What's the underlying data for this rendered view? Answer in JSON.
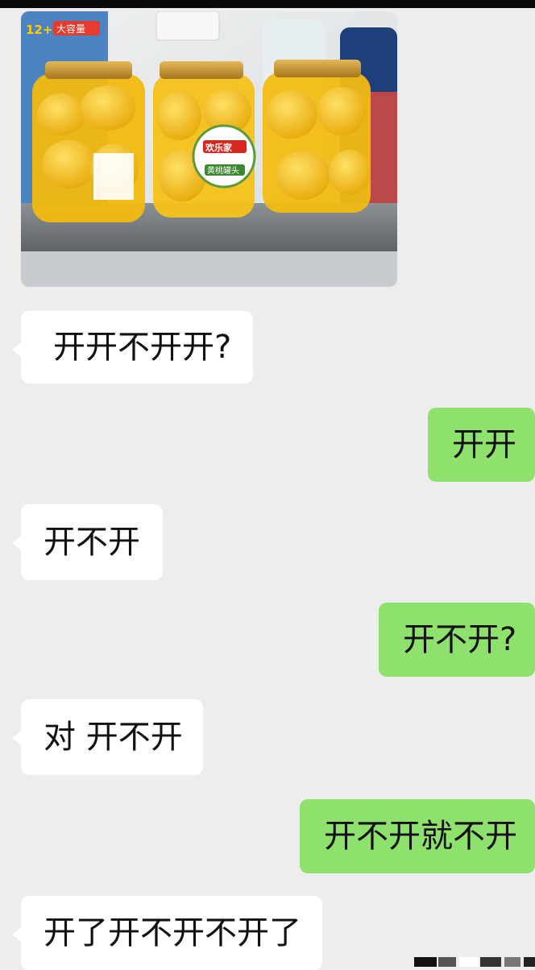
{
  "chat": {
    "messages": [
      {
        "side": "in",
        "text": "开开不开开?"
      },
      {
        "side": "out",
        "text": "开开"
      },
      {
        "side": "in",
        "text": "开不开"
      },
      {
        "side": "out",
        "text": "开不开?"
      },
      {
        "side": "in",
        "text": "对 开不开"
      },
      {
        "side": "out",
        "text": "开不开就不开"
      },
      {
        "side": "in",
        "text": "开了开不开不开了"
      }
    ]
  },
  "photo": {
    "label_brand": "欢乐家",
    "label_product": "黄桃罐头",
    "box_badge": "大容量",
    "box_promo": "12+2"
  },
  "colors": {
    "background": "#ededed",
    "incoming_bubble": "#ffffff",
    "outgoing_bubble": "#8fe16d",
    "jar_lid": "#c9962c",
    "peach": "#f4c21a"
  }
}
